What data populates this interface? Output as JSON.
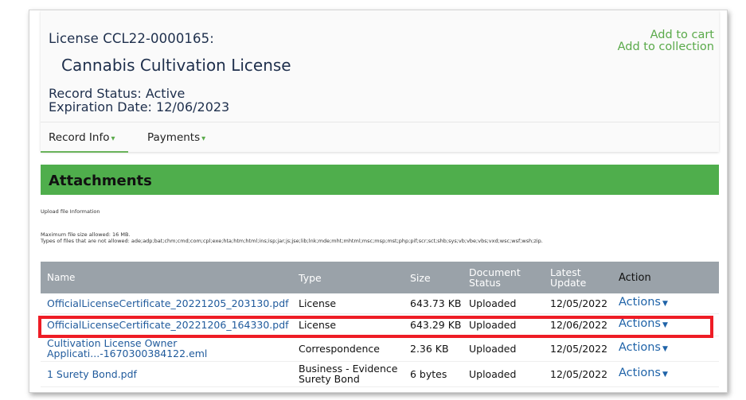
{
  "header": {
    "license_number": "License CCL22-0000165:",
    "license_type": "Cannabis Cultivation License",
    "record_status": "Record Status: Active",
    "expiration": "Expiration Date: 12/06/2023",
    "add_to_cart": "Add to cart",
    "add_to_collection": "Add to collection"
  },
  "tabs": [
    {
      "label": "Record Info",
      "active": true
    },
    {
      "label": "Payments",
      "active": false
    }
  ],
  "attachments": {
    "title": "Attachments",
    "upload_info": "Upload file Information",
    "max_size": "Maximum file size allowed: 16 MB.",
    "not_allowed": "Types of files that are not allowed: ade;adp;bat;chm;cmd;com;cpl;exe;hta;htm;html;ins;isp;jar;js;jse;lib;lnk;mde;mht;mhtml;msc;msp;mst;php;pif;scr;sct;shb;sys;vb;vbe;vbs;vxd;wsc;wsf;wsh;zip."
  },
  "table": {
    "columns": {
      "name": "Name",
      "type": "Type",
      "size": "Size",
      "doc_status_1": "Document",
      "doc_status_2": "Status",
      "latest_1": "Latest",
      "latest_2": "Update",
      "action": "Action"
    },
    "rows": [
      {
        "name": "OfficialLicenseCertificate_20221205_203130.pdf",
        "type": "License",
        "size": "643.73 KB",
        "status": "Uploaded",
        "date": "12/05/2022",
        "action": "Actions"
      },
      {
        "name": "OfficialLicenseCertificate_20221206_164330.pdf",
        "type": "License",
        "size": "643.29 KB",
        "status": "Uploaded",
        "date": "12/06/2022",
        "action": "Actions"
      },
      {
        "name_1": "Cultivation License Owner",
        "name_2": "Applicati...-1670300384122.eml",
        "type": "Correspondence",
        "size": "2.36 KB",
        "status": "Uploaded",
        "date": "12/05/2022",
        "action": "Actions"
      },
      {
        "name": "1 Surety Bond.pdf",
        "type_1": "Business - Evidence",
        "type_2": "Surety Bond",
        "size": "6 bytes",
        "status": "Uploaded",
        "date": "12/05/2022",
        "action": "Actions"
      }
    ]
  },
  "colors": {
    "accent_green": "#4fae4c",
    "link_blue": "#1f5a9c",
    "highlight_red": "#ee1c25"
  }
}
